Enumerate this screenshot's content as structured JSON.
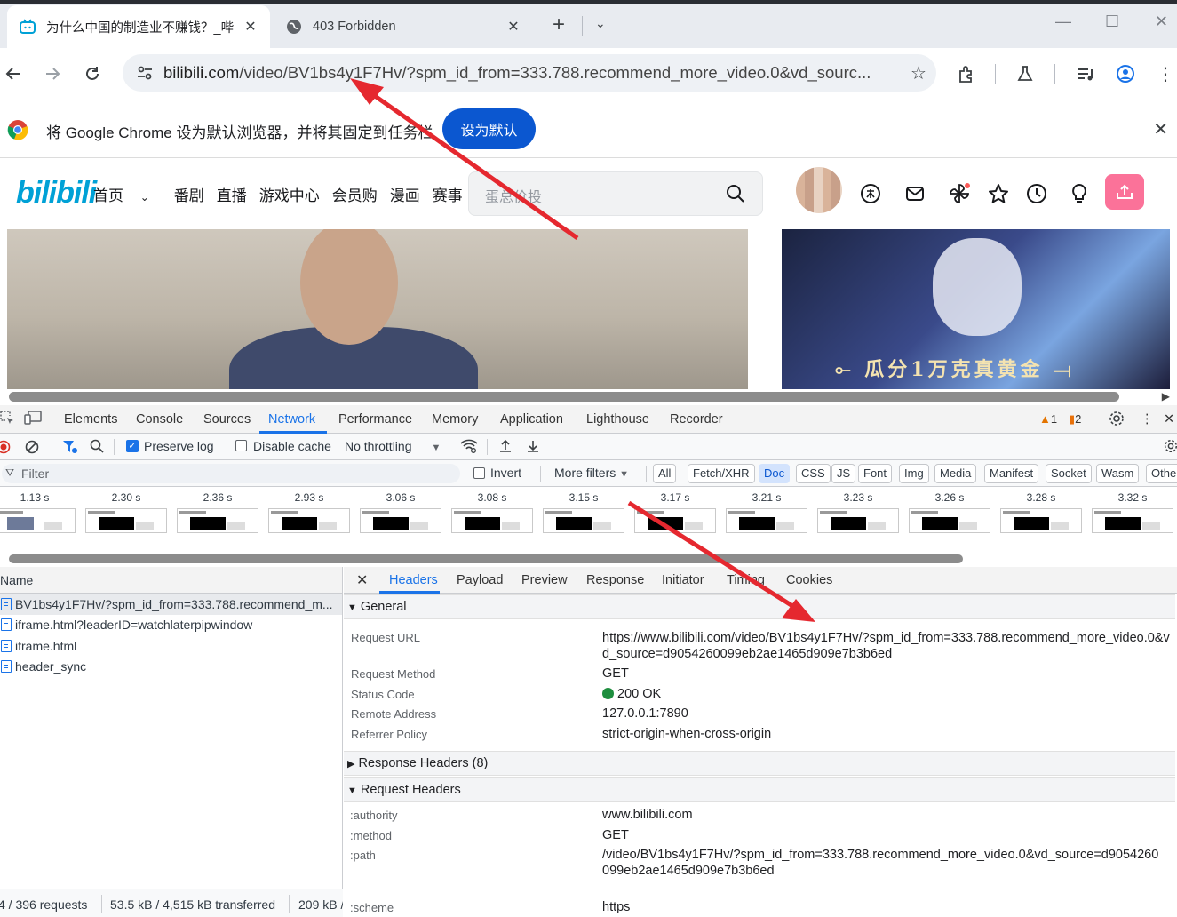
{
  "browser": {
    "tabs": [
      {
        "title": "为什么中国的制造业不赚钱？_哔",
        "active": true
      },
      {
        "title": "403 Forbidden",
        "active": false
      }
    ],
    "url_host": "bilibili.com",
    "url_rest": "/video/BV1bs4y1F7Hv/?spm_id_from=333.788.recommend_more_video.0&vd_sourc...",
    "infobar": {
      "message": "将 Google Chrome 设为默认浏览器，并将其固定到任务栏",
      "button": "设为默认"
    }
  },
  "bilibili": {
    "logo": "bilibili",
    "nav": [
      "首页",
      "番剧",
      "直播",
      "游戏中心",
      "会员购",
      "漫画",
      "赛事"
    ],
    "search_placeholder": "蛋总价投",
    "ad_text": "瓜分1万克真黄金"
  },
  "devtools": {
    "tabs": [
      "Elements",
      "Console",
      "Sources",
      "Network",
      "Performance",
      "Memory",
      "Application",
      "Lighthouse",
      "Recorder"
    ],
    "active_tab": "Network",
    "warnings": "1",
    "issues": "2",
    "toolbar": {
      "preserve_log": "Preserve log",
      "disable_cache": "Disable cache",
      "throttling": "No throttling"
    },
    "filter": {
      "placeholder": "Filter",
      "invert": "Invert",
      "more_filters": "More filters",
      "chips": [
        "All",
        "Fetch/XHR",
        "Doc",
        "CSS",
        "JS",
        "Font",
        "Img",
        "Media",
        "Manifest",
        "Socket",
        "Wasm",
        "Othe"
      ],
      "selected_chip": "Doc"
    },
    "filmstrip_times": [
      "1.13 s",
      "2.30 s",
      "2.36 s",
      "2.93 s",
      "3.06 s",
      "3.08 s",
      "3.15 s",
      "3.17 s",
      "3.21 s",
      "3.23 s",
      "3.26 s",
      "3.28 s",
      "3.32 s"
    ],
    "requests": {
      "header": "Name",
      "rows": [
        "BV1bs4y1F7Hv/?spm_id_from=333.788.recommend_m...",
        "iframe.html?leaderID=watchlaterpipwindow",
        "iframe.html",
        "header_sync"
      ]
    },
    "status": {
      "requests": "4 / 396 requests",
      "transferred": "53.5 kB / 4,515 kB transferred",
      "resources": "209 kB /"
    },
    "detail_tabs": [
      "Headers",
      "Payload",
      "Preview",
      "Response",
      "Initiator",
      "Timing",
      "Cookies"
    ],
    "general": {
      "title": "General",
      "request_url_label": "Request URL",
      "request_url": "https://www.bilibili.com/video/BV1bs4y1F7Hv/?spm_id_from=333.788.recommend_more_video.0&vd_source=d9054260099eb2ae1465d909e7b3b6ed",
      "method_label": "Request Method",
      "method": "GET",
      "status_label": "Status Code",
      "status": "200 OK",
      "remote_label": "Remote Address",
      "remote": "127.0.0.1:7890",
      "referrer_label": "Referrer Policy",
      "referrer": "strict-origin-when-cross-origin"
    },
    "response_headers": "Response Headers (8)",
    "request_headers": {
      "title": "Request Headers",
      "authority_label": ":authority",
      "authority": "www.bilibili.com",
      "method_label": ":method",
      "method": "GET",
      "path_label": ":path",
      "path": "/video/BV1bs4y1F7Hv/?spm_id_from=333.788.recommend_more_video.0&vd_source=d9054260099eb2ae1465d909e7b3b6ed",
      "scheme_label": ":scheme",
      "scheme": "https"
    }
  }
}
